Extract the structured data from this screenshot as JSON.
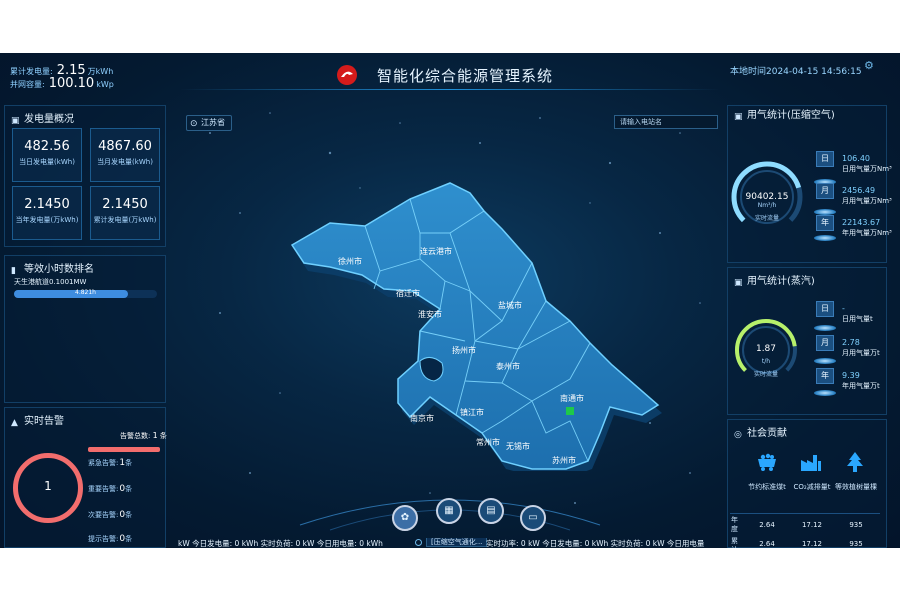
{
  "header": {
    "title": "智能化综合能源管理系统",
    "cum_gen_label": "累计发电量:",
    "cum_gen_value": "2.15",
    "cum_gen_unit": "万kWh",
    "grid_cap_label": "并网容量:",
    "grid_cap_value": "100.10",
    "grid_cap_unit": "kWp",
    "local_time": "本地时间2024-04-15 14:56:15"
  },
  "gen_overview": {
    "title": "发电量概况",
    "kpis": [
      {
        "value": "482.56",
        "label": "当日发电量(kWh)"
      },
      {
        "value": "4867.60",
        "label": "当月发电量(kWh)"
      },
      {
        "value": "2.1450",
        "label": "当年发电量(万kWh)"
      },
      {
        "value": "2.1450",
        "label": "累计发电量(万kWh)"
      }
    ]
  },
  "ranking": {
    "title": "等效小时数排名",
    "item_label": "天生港航道0.1001MW",
    "item_value": "4.821h",
    "item_fraction": 0.8
  },
  "alarms": {
    "title": "实时告警",
    "total_label": "告警总数:",
    "total_count": "1",
    "total_unit": "条",
    "ring_value": "1",
    "items": [
      {
        "label": "紧急告警:",
        "count": "1",
        "unit": "条"
      },
      {
        "label": "重要告警:",
        "count": "0",
        "unit": "条"
      },
      {
        "label": "次要告警:",
        "count": "0",
        "unit": "条"
      },
      {
        "label": "提示告警:",
        "count": "0",
        "unit": "条"
      }
    ]
  },
  "map": {
    "region": "江苏省",
    "search_placeholder": "请输入电站名",
    "cities": [
      "徐州市",
      "连云港市",
      "宿迁市",
      "淮安市",
      "盐城市",
      "扬州市",
      "泰州市",
      "南京市",
      "镇江市",
      "南通市",
      "常州市",
      "无锡市",
      "苏州市"
    ]
  },
  "ticker": {
    "left": "kW  今日发电量: 0 kWh  实时负荷: 0 kW  今日用电量: 0 kWh",
    "chip": "[压缩空气通化...",
    "right": "实时功率: 0 kW  今日发电量: 0 kWh  实时负荷: 0 kW  今日用电量"
  },
  "gas_air": {
    "title": "用气统计(压缩空气)",
    "gauge_value": "90402.15",
    "gauge_unit": "Nm³/h",
    "gauge_label": "实时流量",
    "rows": [
      {
        "tag": "日",
        "value": "106.40",
        "label": "日用气量万Nm³"
      },
      {
        "tag": "月",
        "value": "2456.49",
        "label": "月用气量万Nm³"
      },
      {
        "tag": "年",
        "value": "22143.67",
        "label": "年用气量万Nm³"
      }
    ]
  },
  "gas_steam": {
    "title": "用气统计(蒸汽)",
    "gauge_value": "1.87",
    "gauge_unit": "t/h",
    "gauge_label": "实时流量",
    "rows": [
      {
        "tag": "日",
        "value": "-",
        "label": "日用气量t"
      },
      {
        "tag": "月",
        "value": "2.78",
        "label": "月用气量万t"
      },
      {
        "tag": "年",
        "value": "9.39",
        "label": "年用气量万t"
      }
    ]
  },
  "social": {
    "title": "社会贡献",
    "cols": [
      "节约标准煤t",
      "CO₂减排量t",
      "等效植树量棵"
    ],
    "rows": [
      {
        "label": "年度",
        "values": [
          "2.64",
          "17.12",
          "935"
        ]
      },
      {
        "label": "累计",
        "values": [
          "2.64",
          "17.12",
          "935"
        ]
      }
    ]
  }
}
